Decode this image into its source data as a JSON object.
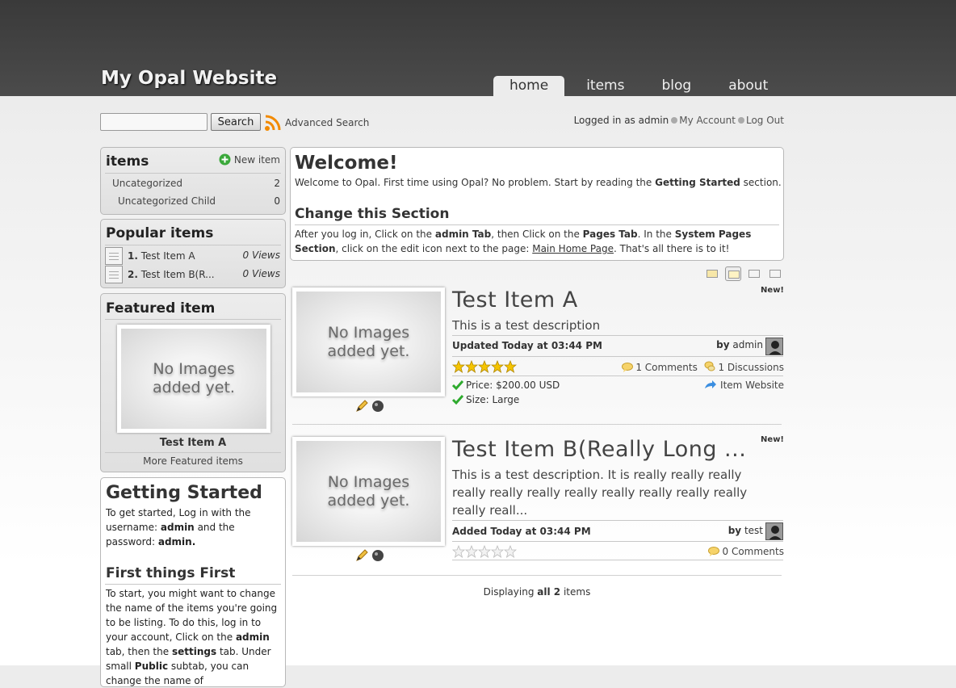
{
  "header": {
    "site_title": "My Opal Website",
    "nav": [
      "home",
      "items",
      "blog",
      "about"
    ],
    "active_tab": "home"
  },
  "search": {
    "value": "",
    "button_label": "Search",
    "advanced_label": "Advanced Search"
  },
  "userbar": {
    "logged_in_prefix": "Logged in as",
    "username": "admin",
    "my_account": "My Account",
    "log_out": "Log Out"
  },
  "sidebar": {
    "items_box": {
      "title": "items",
      "new_item_label": "New item",
      "categories": [
        {
          "label": "Uncategorized",
          "count": "2"
        },
        {
          "label": "Uncategorized Child",
          "count": "0"
        }
      ]
    },
    "popular": {
      "title": "Popular items",
      "rows": [
        {
          "rank": "1.",
          "name": "Test Item A",
          "views": "0 Views"
        },
        {
          "rank": "2.",
          "name": "Test Item B(R...",
          "views": "0 Views"
        }
      ]
    },
    "featured": {
      "title": "Featured item",
      "image_text_line1": "No Images",
      "image_text_line2": "added yet.",
      "item_name": "Test Item A",
      "more_label": "More Featured items"
    },
    "getting_started": {
      "title": "Getting Started",
      "p1_a": "To get started, Log in with the username:",
      "p1_user": "admin",
      "p1_b": "and the password:",
      "p1_pass": "admin.",
      "subtitle": "First things First",
      "p2_a": "To start, you might want to change the name of the items you're going to be listing. To do this, log in to your account, Click on the",
      "p2_admin": "admin",
      "p2_b": "tab, then the",
      "p2_settings": "settings",
      "p2_c": "tab. Under small",
      "p2_public": "Public",
      "p2_d": "subtab, you can change the name of"
    }
  },
  "welcome": {
    "title": "Welcome!",
    "text_a": "Welcome to Opal. First time using Opal? No problem. Start by reading the",
    "text_bold": "Getting Started",
    "text_b": "section.",
    "subtitle": "Change this Section",
    "p_a": "After you log in, Click on the",
    "p_admin": "admin Tab",
    "p_b": ", then Click on the",
    "p_pages": "Pages Tab",
    "p_c": ". In the",
    "p_sys": "System Pages Section",
    "p_d": ", click on the edit icon next to the page:",
    "p_link": "Main Home Page",
    "p_e": ". That's all there is to it!"
  },
  "listing": {
    "items": [
      {
        "title": "Test Item A",
        "new_label": "New!",
        "description": "This is a test description",
        "meta": "Updated Today at 03:44 PM",
        "by_prefix": "by",
        "author": "admin",
        "rating": 5,
        "comments": "1 Comments",
        "discussions": "1 Discussions",
        "price": "Price: $200.00 USD",
        "size": "Size: Large",
        "website": "Item Website",
        "image_text_line1": "No Images",
        "image_text_line2": "added yet."
      },
      {
        "title": "Test Item B(Really Long ...",
        "new_label": "New!",
        "description": "This is a test description. It is really really really really really really really really really really really really reall...",
        "meta": "Added Today at 03:44 PM",
        "by_prefix": "by",
        "author": "test",
        "rating": 0,
        "comments": "0 Comments",
        "image_text_line1": "No Images",
        "image_text_line2": "added yet."
      }
    ],
    "footer_a": "Displaying",
    "footer_b": "all 2",
    "footer_c": "items"
  },
  "colors": {
    "header_bg": "#3f3f3f",
    "star": "#f5c400",
    "check": "#2eaa2e",
    "rss": "#f28a00",
    "plus": "#3aa83a"
  },
  "icons": [
    "rss-icon",
    "plus-icon",
    "star-icon",
    "comment-icon",
    "discussion-icon",
    "check-icon",
    "arrow-icon",
    "pencil-icon",
    "ball-icon",
    "avatar-icon",
    "view-mode-icon"
  ]
}
